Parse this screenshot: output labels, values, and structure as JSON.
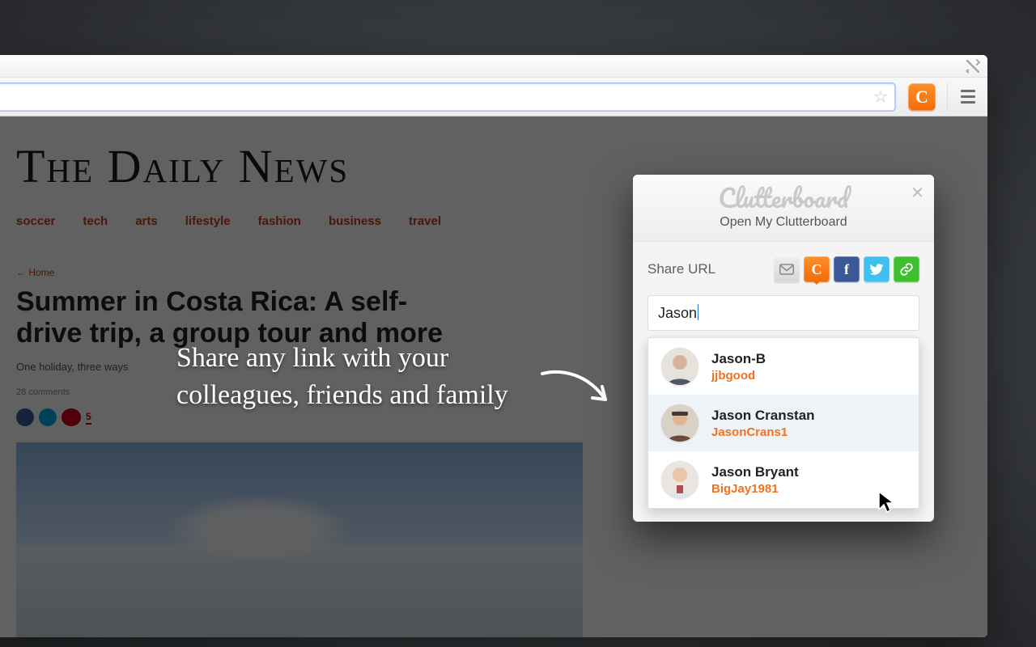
{
  "page": {
    "masthead": "The Daily News",
    "nav": [
      "soccer",
      "tech",
      "arts",
      "lifestyle",
      "fashion",
      "business",
      "travel"
    ],
    "crumb": "← Home",
    "headline": "Summer in Costa Rica: A self-drive trip, a group tour and more",
    "sub": "One holiday, three ways",
    "meta_comments": "28 comments",
    "share_count": "5"
  },
  "promo": {
    "text": "Share any link with your colleagues, friends and family"
  },
  "popup": {
    "brand": "Clutterboard",
    "open_link": "Open My Clutterboard",
    "share_label": "Share URL",
    "icons": {
      "mail": "mail-icon",
      "clutterboard": "C",
      "facebook": "f",
      "twitter": "t",
      "link": "link-icon"
    },
    "search_value": "Jason",
    "suggestions": [
      {
        "name": "Jason-B",
        "handle": "jjbgood",
        "hover": false
      },
      {
        "name": "Jason Cranstan",
        "handle": "JasonCrans1",
        "hover": true
      },
      {
        "name": "Jason Bryant",
        "handle": "BigJay1981",
        "hover": false
      }
    ]
  }
}
